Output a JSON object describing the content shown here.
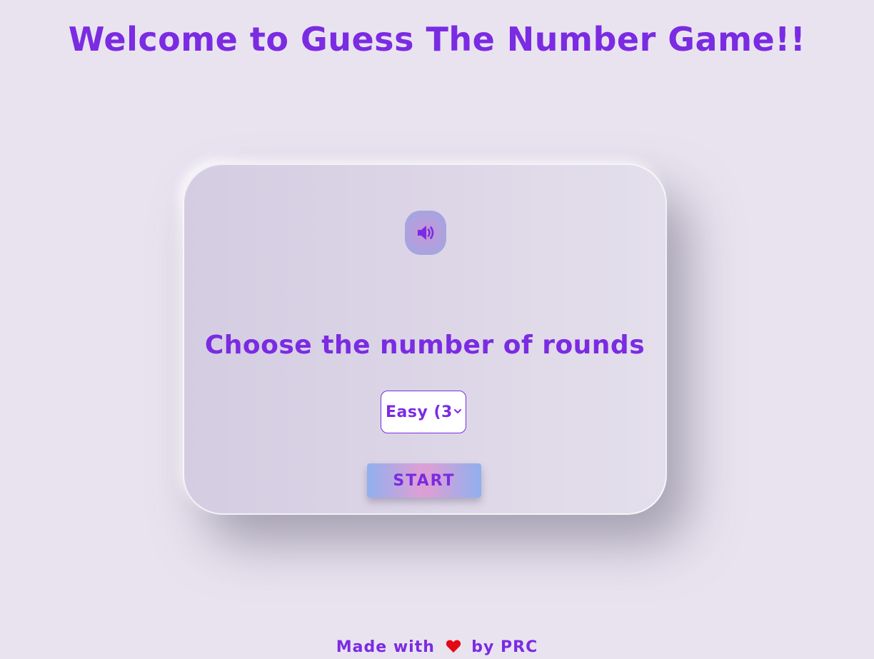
{
  "header": {
    "title": "Welcome to Guess The Number Game!!"
  },
  "card": {
    "sound_icon": "speaker-volume-icon",
    "heading": "Choose the number of rounds",
    "rounds_select": {
      "selected_label": "Easy (3"
    },
    "start_label": "START"
  },
  "footer": {
    "prefix": "Made with",
    "heart_icon": "heart-icon",
    "suffix": "by PRC"
  },
  "colors": {
    "accent": "#7b2be2",
    "background": "#e9e3f0",
    "heart": "#e50914"
  }
}
